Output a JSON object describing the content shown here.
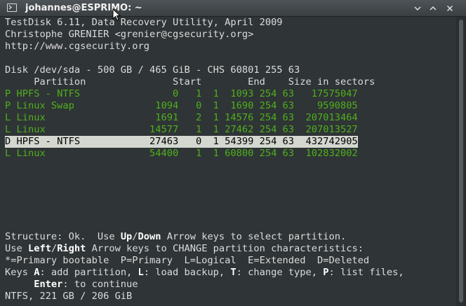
{
  "window": {
    "title": "johannes@ESPRIMO: ~",
    "buttons": [
      "minimize",
      "maximize",
      "close"
    ]
  },
  "terminal": {
    "header": [
      "TestDisk 6.11, Data Recovery Utility, April 2009",
      "Christophe GRENIER <grenier@cgsecurity.org>",
      "http://www.cgsecurity.org"
    ],
    "disk_line": "Disk /dev/sda - 500 GB / 465 GiB - CHS 60801 255 63",
    "columns_line": "     Partition               Start        End    Size in sectors",
    "partitions": [
      {
        "text": "P HPFS - NTFS                0   1  1  1093 254 63   17575047",
        "selected": false
      },
      {
        "text": "P Linux Swap              1094   0  1  1690 254 63    9590805",
        "selected": false
      },
      {
        "text": "L Linux                   1691   2  1 14576 254 63  207013464",
        "selected": false
      },
      {
        "text": "L Linux                  14577   1  1 27462 254 63  207013527",
        "selected": false
      },
      {
        "text": "D HPFS - NTFS            27463   0  1 54399 254 63  432742905",
        "selected": true
      },
      {
        "text": "L Linux                  54400   1  1 60800 254 63  102832002",
        "selected": false
      }
    ],
    "footer": {
      "l1_a": "Structure: Ok.  Use ",
      "l1_up": "Up",
      "l1_slash": "/",
      "l1_down": "Down",
      "l1_b": " Arrow keys to select partition.",
      "l2_a": "Use ",
      "l2_left": "Left",
      "l2_slash": "/",
      "l2_right": "Right",
      "l2_b": " Arrow keys to CHANGE partition characteristics:",
      "l3": "*=Primary bootable  P=Primary  L=Logical  E=Extended  D=Deleted",
      "l4_a": "Keys ",
      "l4_A": "A",
      "l4_b": ": add partition, ",
      "l4_L": "L",
      "l4_c": ": load backup, ",
      "l4_T": "T",
      "l4_d": ": change type, ",
      "l4_P": "P",
      "l4_e": ": list files,",
      "l5_indent": "     ",
      "l5_enter": "Enter",
      "l5_b": ": to continue",
      "l6": "NTFS, 221 GB / 206 GiB"
    }
  }
}
